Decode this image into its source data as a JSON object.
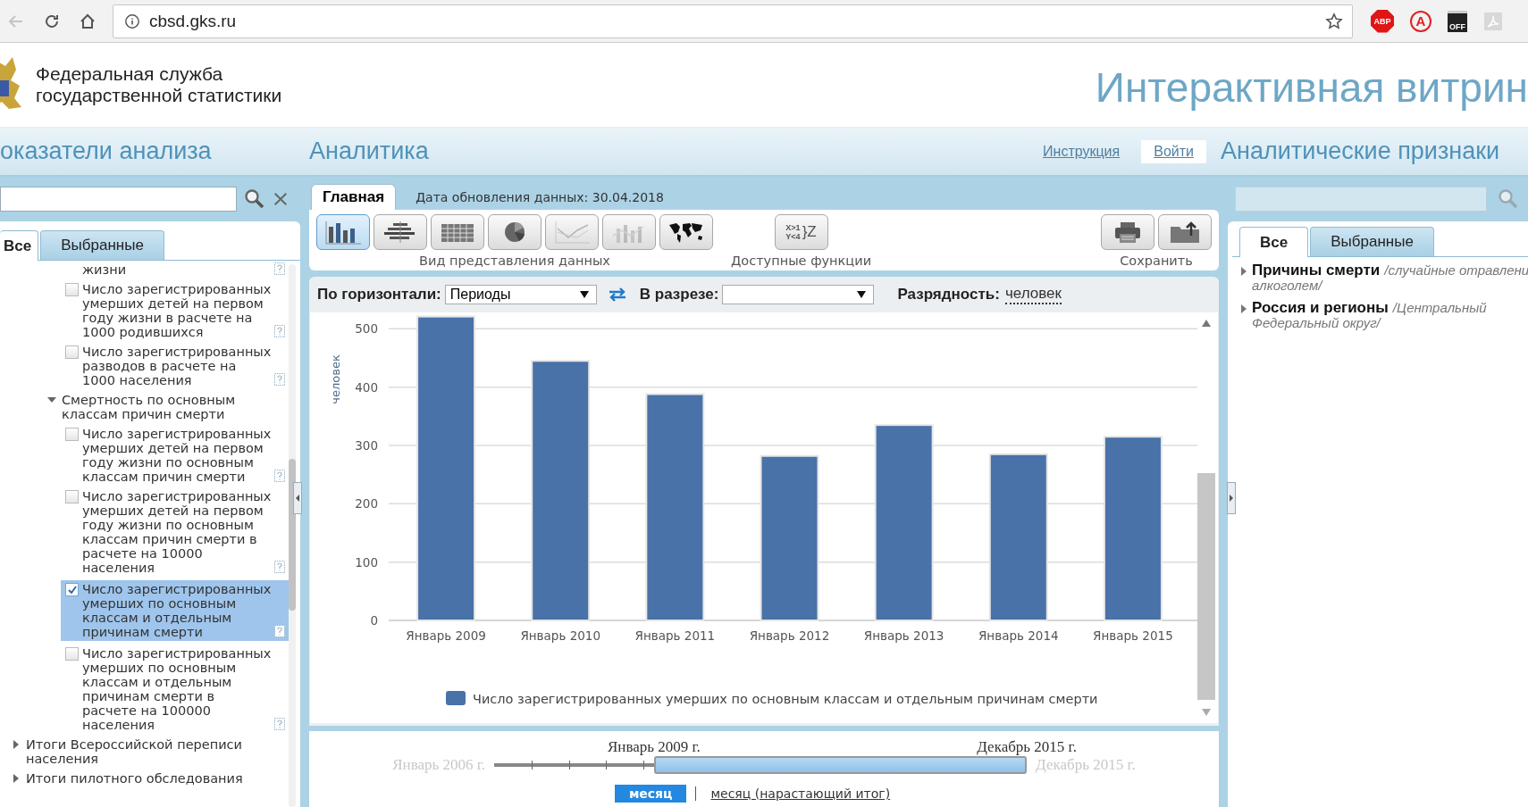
{
  "browser": {
    "back_disabled": true,
    "url": "cbsd.gks.ru",
    "extensions": [
      {
        "kind": "abp",
        "label": "ABP"
      },
      {
        "kind": "circle",
        "label": "A"
      },
      {
        "kind": "off",
        "label": "OFF"
      },
      {
        "kind": "pdf"
      }
    ]
  },
  "header": {
    "org_lines": [
      "Федеральная служба",
      "государственной статистики"
    ],
    "title": "Интерактивная витрин"
  },
  "nav": {
    "left": "оказатели анализа",
    "center": "Аналитика",
    "instructions_link": "Инструкция",
    "login_button": "Войти",
    "right": "Аналитические признаки"
  },
  "left_panel": {
    "tabs": [
      {
        "label": "Все",
        "selected": true
      },
      {
        "label": "Выбранные",
        "selected": false
      }
    ],
    "tree": [
      {
        "kind": "group",
        "children": [
          {
            "kind": "group",
            "children": [
              {
                "kind": "group",
                "children": [
                  {
                    "kind": "continuation",
                    "label": "жизни"
                  },
                  {
                    "kind": "leaf",
                    "label": "Число зарегистрированных умерших детей на первом году жизни в расчете на 1000 родившихся",
                    "checked": false,
                    "selected": false
                  },
                  {
                    "kind": "leaf",
                    "label": "Число зарегистрированных разводов в расчете на 1000 населения",
                    "checked": false,
                    "selected": false
                  }
                ]
              },
              {
                "kind": "group",
                "label": "Смертность по основным классам причин смерти",
                "expanded": true,
                "children": [
                  {
                    "kind": "leaf",
                    "label": "Число зарегистрированных умерших детей на первом году жизни по основным классам причин смерти",
                    "checked": false,
                    "selected": false
                  },
                  {
                    "kind": "leaf",
                    "label": "Число зарегистрированных умерших детей на первом году жизни по основным классам причин смерти в расчете на 10000 населения",
                    "checked": false,
                    "selected": false
                  },
                  {
                    "kind": "leaf",
                    "label": "Число зарегистрированных умерших по основным классам и отдельным причинам смерти",
                    "checked": true,
                    "selected": true
                  },
                  {
                    "kind": "leaf",
                    "label": "Число зарегистрированных умерших по основным классам и отдельным причинам смерти в расчете на 100000 населения",
                    "checked": false,
                    "selected": false
                  }
                ]
              }
            ]
          }
        ]
      },
      {
        "kind": "group",
        "label": "Итоги Всероссийской переписи населения",
        "expanded": false
      },
      {
        "kind": "group",
        "label": "Итоги пилотного обследования",
        "expanded": false
      }
    ]
  },
  "center": {
    "main_tab": {
      "label": "Главная",
      "selected": true
    },
    "update_date": "Дата обновления данных: 30.04.2018",
    "view_buttons": [
      {
        "kind": "bar",
        "selected": true,
        "disabled": false
      },
      {
        "kind": "hbar",
        "selected": false,
        "disabled": false
      },
      {
        "kind": "table",
        "selected": false,
        "disabled": false
      },
      {
        "kind": "pie",
        "selected": false,
        "disabled": false
      },
      {
        "kind": "line",
        "selected": false,
        "disabled": true
      },
      {
        "kind": "combo",
        "selected": false,
        "disabled": true
      },
      {
        "kind": "map",
        "selected": false,
        "disabled": false
      }
    ],
    "view_caption": "Вид представления данных",
    "function_button": {
      "lines": [
        "X>1",
        "Y<4"
      ],
      "suffix": "}Z"
    },
    "functions_caption": "Доступные функции",
    "save_buttons": [
      {
        "kind": "print"
      },
      {
        "kind": "export"
      }
    ],
    "save_caption": "Сохранить",
    "filters": {
      "horizontal_label": "По горизонтали:",
      "horizontal_value": "Периоды",
      "slice_label": "В разрезе:",
      "scale_label": "Разрядность:",
      "scale_value": "человек"
    },
    "chart_data": {
      "type": "bar",
      "ylabel": "человек",
      "categories": [
        "Январь 2009",
        "Январь 2010",
        "Январь 2011",
        "Январь 2012",
        "Январь 2013",
        "Январь 2014",
        "Январь 2015"
      ],
      "series": [
        {
          "name": "Число зарегистрированных умерших по основным классам и отдельным причинам смерти",
          "color": "#4872a8",
          "values": [
            521,
            445,
            388,
            282,
            335,
            285,
            315
          ]
        }
      ],
      "ylim": [
        0,
        525
      ],
      "yticks": [
        0,
        100,
        200,
        300,
        400,
        500
      ],
      "grid": true
    },
    "period_slider": {
      "min_label": "Январь 2006 г.",
      "max_label": "Декабрь 2015 г.",
      "from_label": "Январь 2009 г.",
      "to_label": "Декабрь 2015 г.",
      "level": 0.7
    },
    "period_modes": [
      {
        "label": "месяц",
        "selected": true
      },
      {
        "label": "месяц (нарастающий итог)",
        "selected": false
      }
    ]
  },
  "right_panel": {
    "tabs": [
      {
        "label": "Все",
        "selected": true
      },
      {
        "label": "Выбранные",
        "selected": false
      }
    ],
    "items": [
      {
        "name": "Причины смерти",
        "detail_lines": [
          "/случайные отравлени",
          "алкоголем/"
        ]
      },
      {
        "name": "Россия и регионы",
        "detail_lines": [
          "/Центральный",
          "Федеральный округ/"
        ]
      }
    ]
  }
}
